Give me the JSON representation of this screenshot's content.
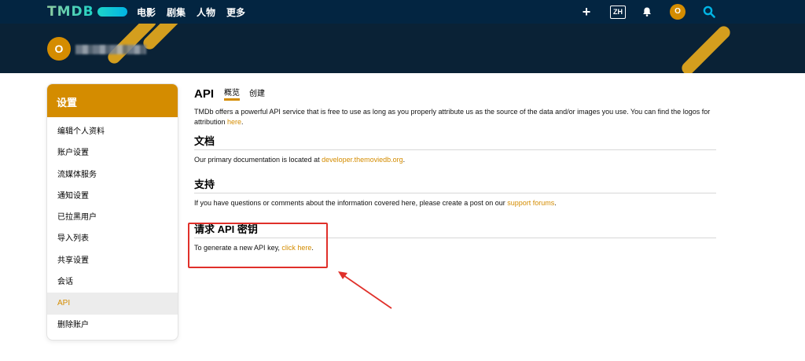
{
  "nav": {
    "logo": "TMDB",
    "items": [
      "电影",
      "剧集",
      "人物",
      "更多"
    ],
    "lang": "ZH",
    "avatar_initial": "O"
  },
  "banner": {
    "avatar_initial": "O"
  },
  "sidebar": {
    "title": "设置",
    "items": [
      "编辑个人资料",
      "账户设置",
      "流媒体服务",
      "通知设置",
      "已拉黑用户",
      "导入列表",
      "共享设置",
      "会话",
      "API",
      "删除账户"
    ],
    "active": "API"
  },
  "main": {
    "title": "API",
    "tabs": [
      "概览",
      "创建"
    ],
    "intro_before": "TMDb offers a powerful API service that is free to use as long as you properly attribute us as the source of the data and/or images you use. You can find the logos for attribution ",
    "intro_link": "here",
    "intro_after": ".",
    "docs_title": "文档",
    "docs_before": "Our primary documentation is located at ",
    "docs_link": "developer.themoviedb.org",
    "docs_after": ".",
    "support_title": "支持",
    "support_before": "If you have questions or comments about the information covered here, please create a post on our ",
    "support_link": "support forums",
    "support_after": ".",
    "key_title": "请求 API 密钥",
    "key_before": "To generate a new API key, ",
    "key_link": "click here",
    "key_after": "."
  },
  "colors": {
    "nav_bg": "#032541",
    "accent": "#d48c00",
    "annotation": "#e0302a"
  }
}
